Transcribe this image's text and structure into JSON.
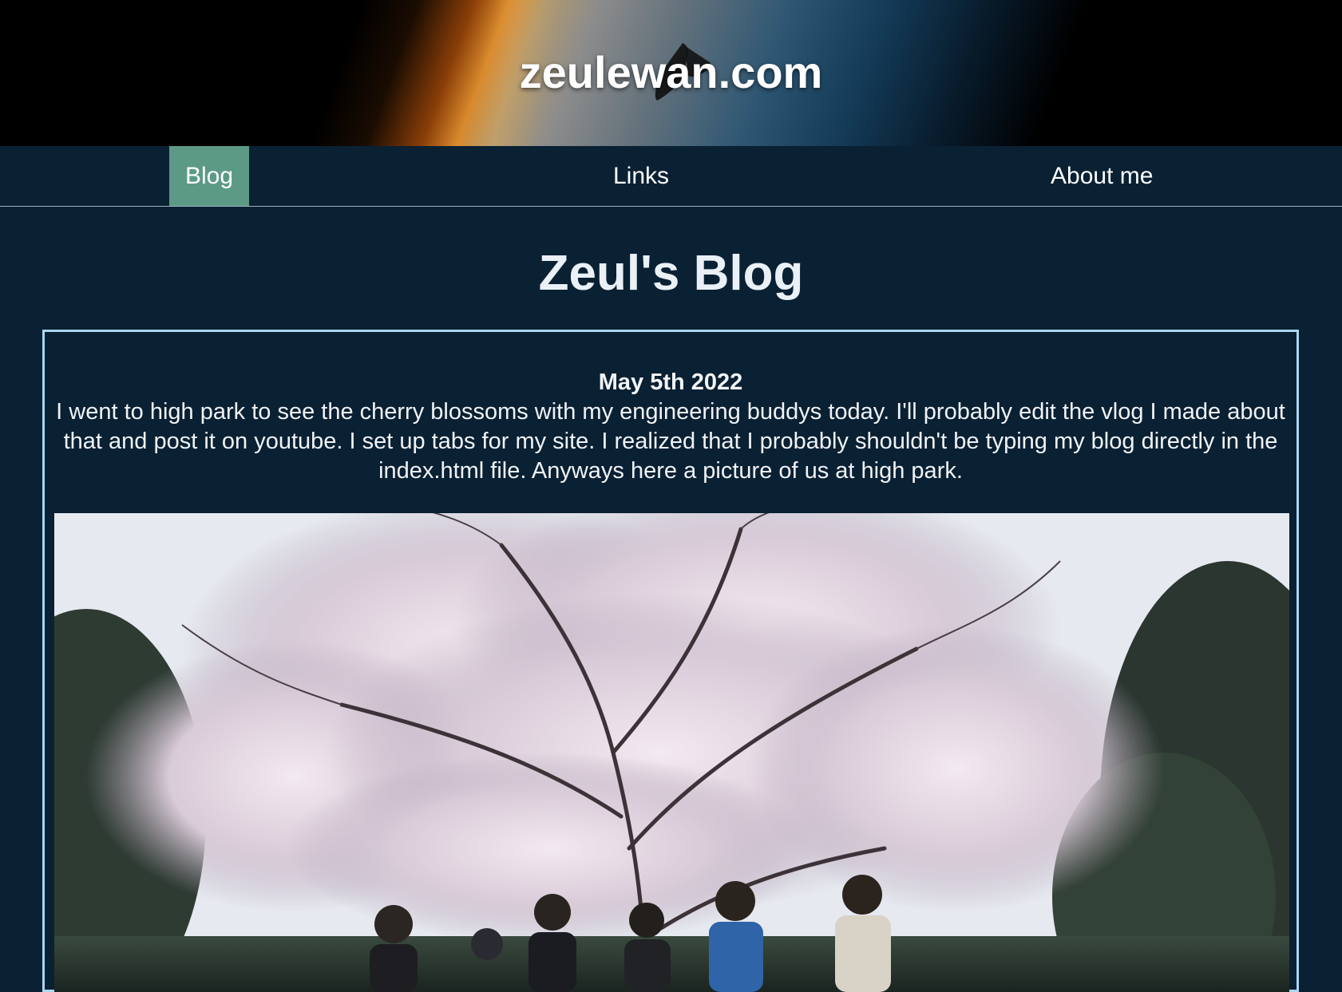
{
  "site": {
    "title": "zeulewan.com"
  },
  "nav": {
    "tabs": [
      {
        "label": "Blog",
        "active": true
      },
      {
        "label": "Links",
        "active": false
      },
      {
        "label": "About me",
        "active": false
      }
    ]
  },
  "page": {
    "heading": "Zeul's Blog"
  },
  "post": {
    "date": "May 5th 2022",
    "body": "I went to high park to see the cherry blossoms with my engineering buddys today. I'll probably edit the vlog I made about that and post it on youtube. I set up tabs for my site. I realized that I probably shouldn't be typing my blog directly in the index.html file. Anyways here a picture of us at high park.",
    "photo_description": ""
  },
  "colors": {
    "background": "#0a2033",
    "active_tab": "#5c9a86",
    "post_border": "#a9d6f0"
  }
}
